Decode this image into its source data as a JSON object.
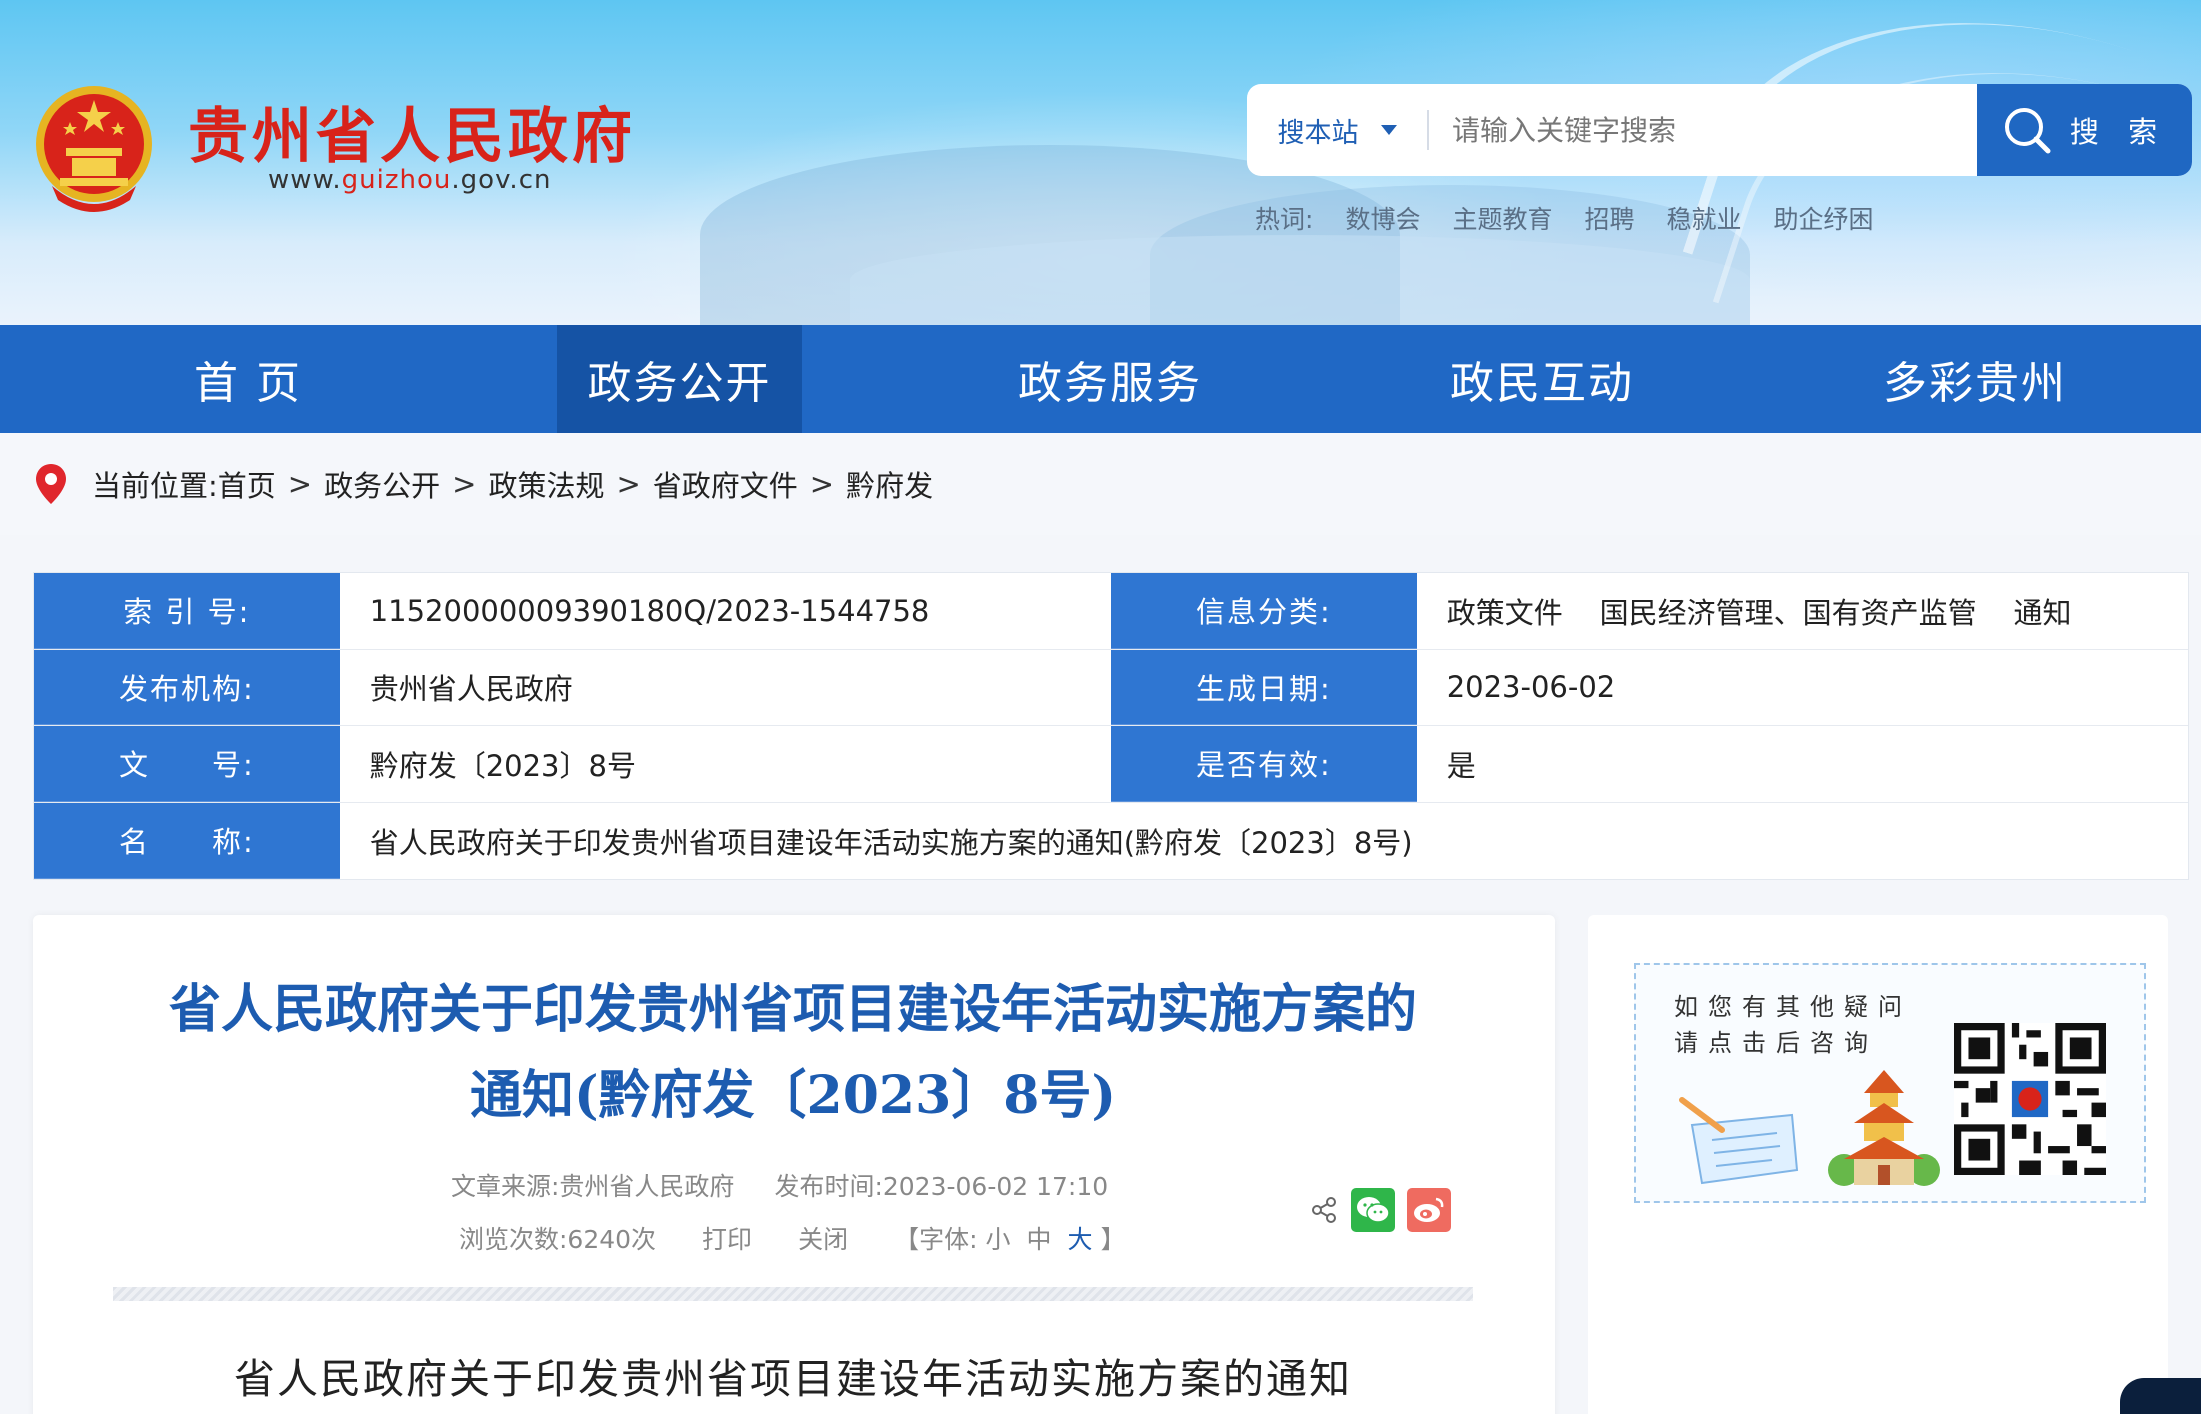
{
  "header": {
    "site_title": "贵州省人民政府",
    "site_url_prefix": "www.",
    "site_url_domain": "guizhou",
    "site_url_suffix": ".gov.cn",
    "search": {
      "scope_label": "搜本站",
      "placeholder": "请输入关键字搜索",
      "button_label": "搜 索"
    },
    "hotwords": {
      "label": "热词:",
      "items": [
        "数博会",
        "主题教育",
        "招聘",
        "稳就业",
        "助企纾困"
      ]
    }
  },
  "nav": {
    "items": [
      "首  页",
      "政务公开",
      "政务服务",
      "政民互动",
      "多彩贵州"
    ],
    "active": "政务公开"
  },
  "breadcrumb": {
    "label": "当前位置:",
    "items": [
      "首页",
      "政务公开",
      "政策法规",
      "省政府文件",
      "黔府发"
    ],
    "separator": ">"
  },
  "info": {
    "index_label": "索 引 号:",
    "index_value": "11520000009390180Q/2023-1544758",
    "category_label": "信息分类:",
    "category_value": "政策文件    国民经济管理、国有资产监管    通知",
    "publisher_label": "发布机构:",
    "publisher_value": "贵州省人民政府",
    "date_label": "生成日期:",
    "date_value": "2023-06-02",
    "docno_label": "文　　号:",
    "docno_value": "黔府发〔2023〕8号",
    "valid_label": "是否有效:",
    "valid_value": "是",
    "name_label": "名　　称:",
    "name_value": "省人民政府关于印发贵州省项目建设年活动实施方案的通知(黔府发〔2023〕8号)"
  },
  "article": {
    "title_line1": "省人民政府关于印发贵州省项目建设年活动实施方案的",
    "title_line2": "通知(黔府发〔2023〕8号)",
    "source": "文章来源:贵州省人民政府",
    "published": "发布时间:2023-06-02 17:10",
    "views": "浏览次数:6240次",
    "print_label": "打印",
    "close_label": "关闭",
    "font_label_open": "【字体:",
    "font_small": "小",
    "font_medium": "中",
    "font_large": "大",
    "font_label_close": "】",
    "body_title": "省人民政府关于印发贵州省项目建设年活动实施方案的通知"
  },
  "side": {
    "qr_text_line1": "如您有其他疑问",
    "qr_text_line2": "请点击后咨询"
  },
  "colors": {
    "nav_blue": "#2068c5",
    "nav_active": "#1553a5",
    "title_blue": "#1d5cb0",
    "brand_red": "#d8231a",
    "label_blue": "#2f76d2"
  }
}
